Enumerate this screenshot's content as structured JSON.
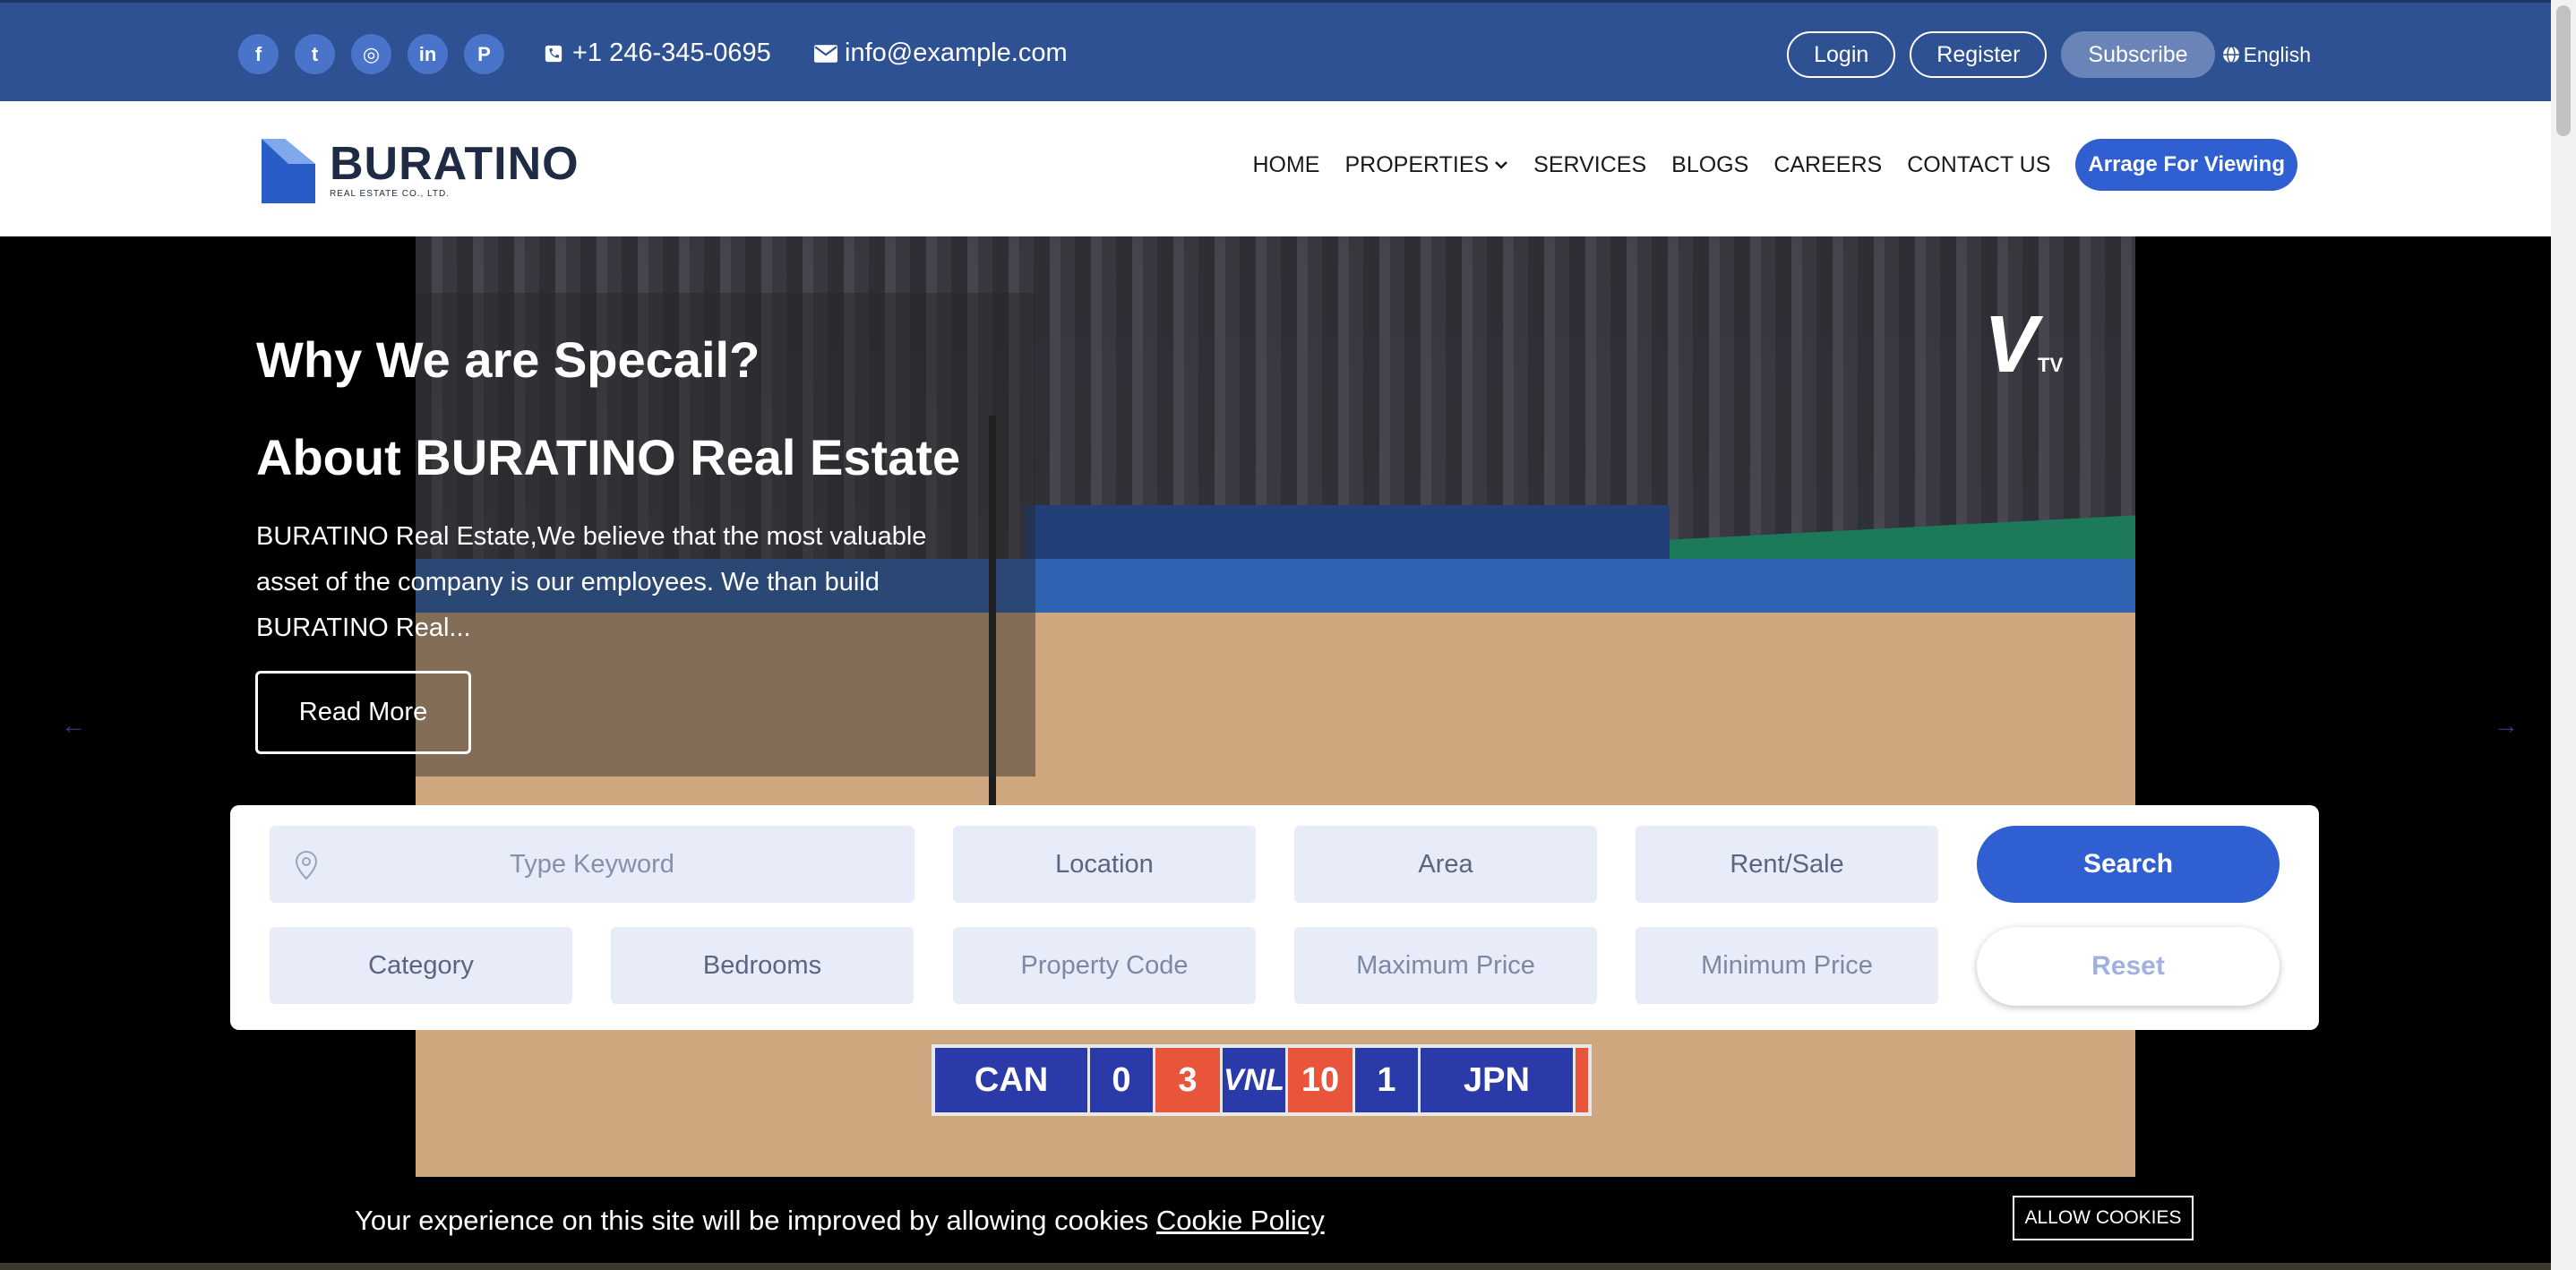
{
  "topbar": {
    "social": [
      {
        "name": "facebook-icon",
        "glyph": "f"
      },
      {
        "name": "twitter-icon",
        "glyph": "t"
      },
      {
        "name": "instagram-icon",
        "glyph": "◎"
      },
      {
        "name": "linkedin-icon",
        "glyph": "in"
      },
      {
        "name": "pinterest-icon",
        "glyph": "P"
      }
    ],
    "phone": "+1 246-345-0695",
    "email": "info@example.com",
    "login": "Login",
    "register": "Register",
    "subscribe": "Subscribe",
    "language": "English"
  },
  "nav": {
    "logo_name": "BURATINO",
    "logo_sub": "REAL ESTATE CO., LTD.",
    "items": [
      "HOME",
      "PROPERTIES",
      "SERVICES",
      "BLOGS",
      "CAREERS",
      "CONTACT US"
    ],
    "cta": "Arrage For Viewing"
  },
  "hero": {
    "heading1": "Why We are Specail?",
    "heading2": "About BURATINO Real Estate",
    "description": "BURATINO Real Estate,We believe that the most valuable asset of the company is our employees. We than build BURATINO Real...",
    "read_more": "Read More",
    "prev_arrow": "←",
    "next_arrow": "→",
    "video": {
      "watermark": "V",
      "watermark_sub": "TV",
      "score": {
        "team_a": "CAN",
        "sets_a": "0",
        "points_a": "3",
        "logo": "VNL",
        "points_b": "10",
        "sets_b": "1",
        "team_b": "JPN"
      }
    }
  },
  "search": {
    "keyword_placeholder": "Type Keyword",
    "location": "Location",
    "area": "Area",
    "rent_sale": "Rent/Sale",
    "search_button": "Search",
    "category": "Category",
    "bedrooms": "Bedrooms",
    "property_code": "Property Code",
    "max_price": "Maximum Price",
    "min_price": "Minimum Price",
    "reset_button": "Reset"
  },
  "cookie": {
    "message": "Your experience on this site will be improved by allowing cookies",
    "policy_link": "Cookie Policy",
    "allow_button": "ALLOW COOKIES"
  },
  "colors": {
    "topbar": "#2d5192",
    "accent": "#2f5fd0",
    "field_bg": "#e7ecf8"
  }
}
